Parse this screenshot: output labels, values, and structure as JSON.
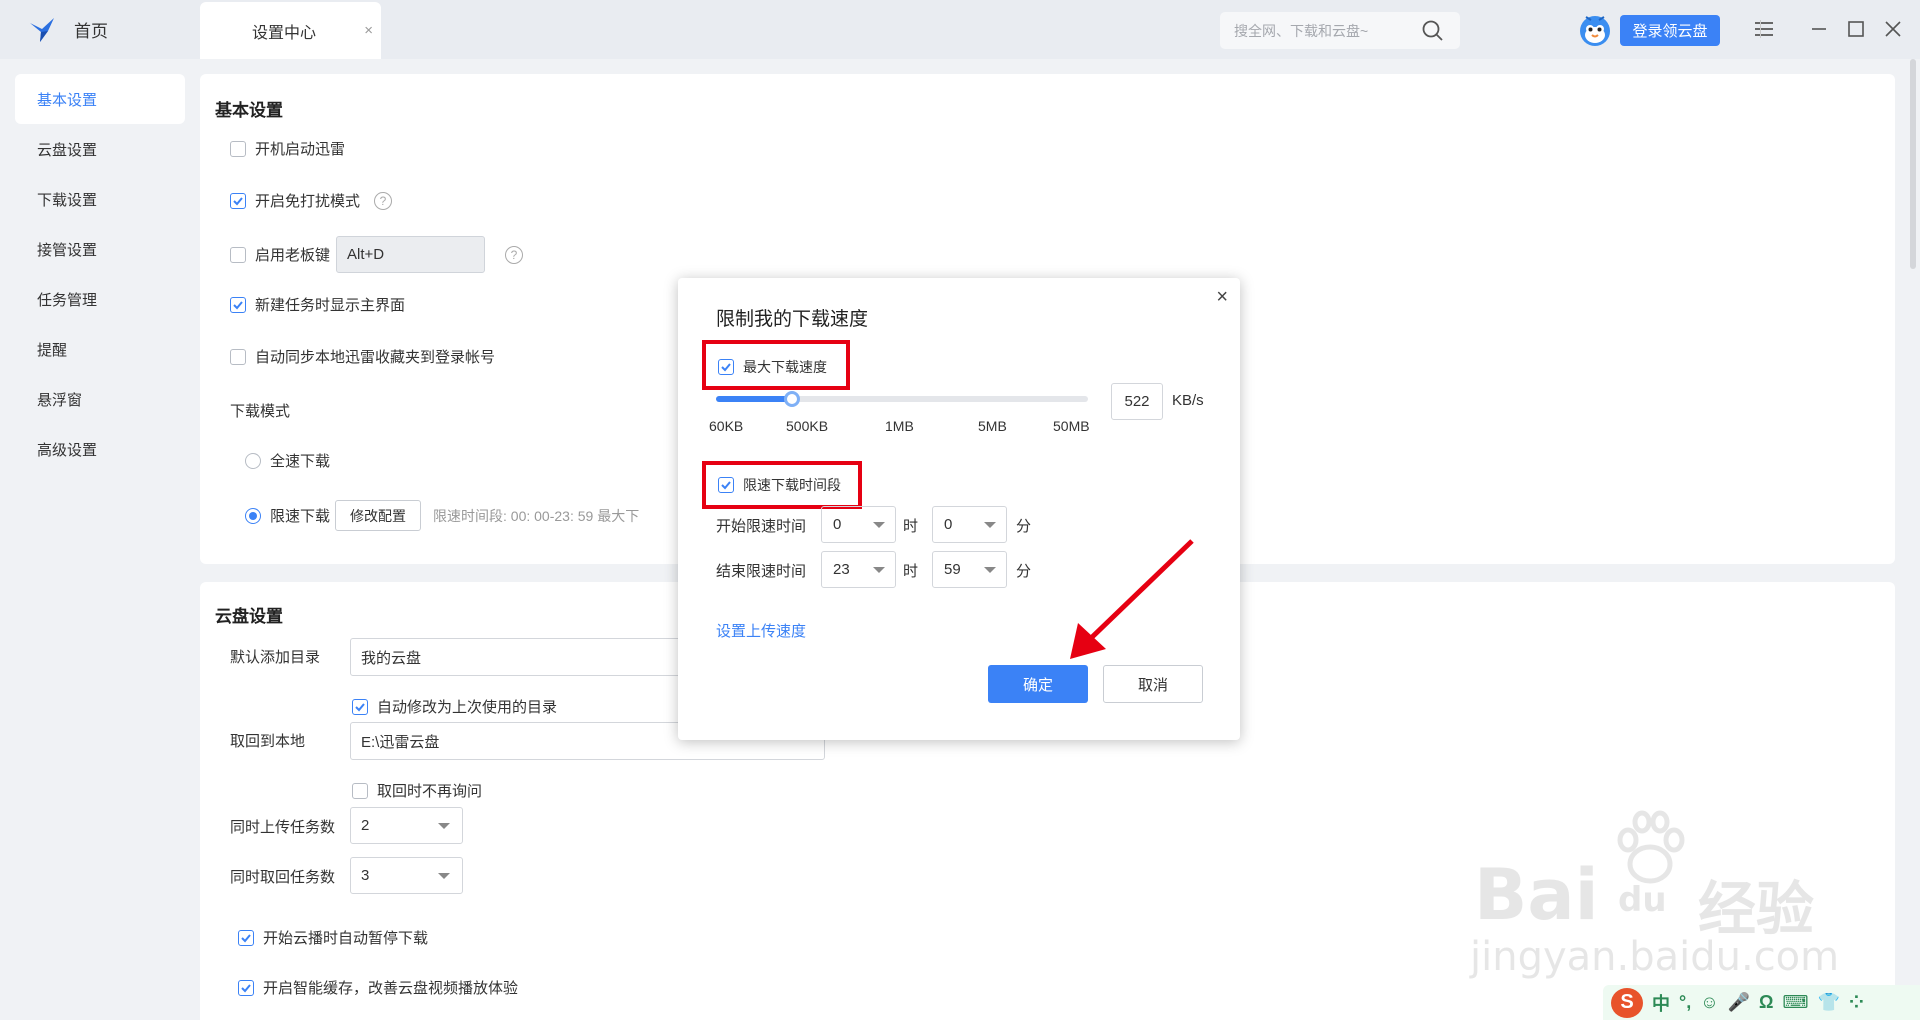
{
  "titlebar": {
    "home_label": "首页",
    "tab_label": "设置中心",
    "tab_close": "×",
    "search_placeholder": "搜全网、下载和云盘~",
    "login_label": "登录领云盘"
  },
  "sidebar": {
    "items": [
      {
        "label": "基本设置"
      },
      {
        "label": "云盘设置"
      },
      {
        "label": "下载设置"
      },
      {
        "label": "接管设置"
      },
      {
        "label": "任务管理"
      },
      {
        "label": "提醒"
      },
      {
        "label": "悬浮窗"
      },
      {
        "label": "高级设置"
      }
    ],
    "active_index": 0
  },
  "basic": {
    "title": "基本设置",
    "autostart": {
      "label": "开机启动迅雷",
      "checked": false
    },
    "dnd": {
      "label": "开启免打扰模式",
      "checked": true
    },
    "bosskey": {
      "label": "启用老板键",
      "checked": false,
      "value": "Alt+D"
    },
    "show_main": {
      "label": "新建任务时显示主界面",
      "checked": true
    },
    "sync_fav": {
      "label": "自动同步本地迅雷收藏夹到登录帐号",
      "checked": false
    },
    "mode_title": "下载模式",
    "mode_full": "全速下载",
    "mode_limit": "限速下载",
    "modify_btn": "修改配置",
    "limit_info": "限速时间段:  00: 00-23: 59   最大下"
  },
  "cloud": {
    "title": "云盘设置",
    "default_dir_label": "默认添加目录",
    "default_dir_value": "我的云盘",
    "auto_modify": {
      "label": "自动修改为上次使用的目录",
      "checked": true
    },
    "local_label": "取回到本地",
    "local_value": "E:\\迅雷云盘",
    "no_ask": {
      "label": "取回时不再询问",
      "checked": false
    },
    "upload_label": "同时上传任务数",
    "upload_value": "2",
    "fetch_label": "同时取回任务数",
    "fetch_value": "3",
    "pause_on_play": {
      "label": "开始云播时自动暂停下载",
      "checked": true
    },
    "smart_cache": {
      "label": "开启智能缓存，改善云盘视频播放体验",
      "checked": true
    }
  },
  "modal": {
    "title": "限制我的下载速度",
    "close": "×",
    "max_speed": {
      "label": "最大下载速度",
      "checked": true
    },
    "slider_ticks": [
      "60KB",
      "500KB",
      "1MB",
      "5MB",
      "50MB"
    ],
    "slider_fraction": 0.205,
    "speed_value": "522",
    "speed_unit": "KB/s",
    "limit_period": {
      "label": "限速下载时间段",
      "checked": true
    },
    "start_label": "开始限速时间",
    "end_label": "结束限速时间",
    "start_hour": "0",
    "start_min": "0",
    "end_hour": "23",
    "end_min": "59",
    "hour_unit": "时",
    "min_unit": "分",
    "upload_link": "设置上传速度",
    "ok": "确定",
    "cancel": "取消"
  },
  "watermark": {
    "brand": "Bai",
    "brand2": "du",
    "cn": "经验",
    "url": "jingyan.baidu.com"
  },
  "ime": {
    "logo": "S",
    "items": [
      "中",
      "°,",
      "☺",
      "🎤",
      "Ω",
      "⌨",
      "👕",
      "⁘"
    ]
  },
  "colors": {
    "accent": "#3b82f6",
    "highlight": "#e60012",
    "arrow": "#e60012"
  }
}
